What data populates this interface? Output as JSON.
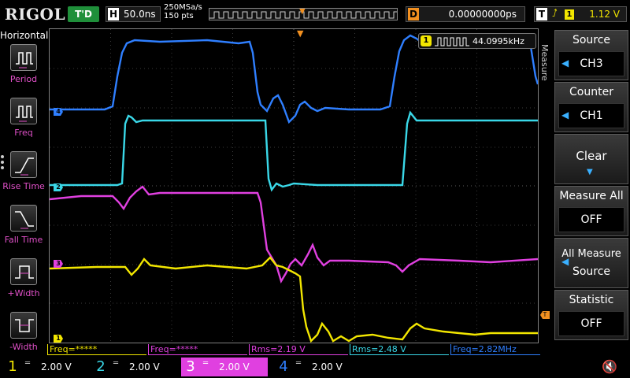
{
  "top": {
    "brand": "RIGOL",
    "trigger_status": "T'D",
    "timebase_label": "H",
    "timebase_value": "50.0ns",
    "sample_rate": "250MSa/s",
    "memory_depth": "150 pts",
    "delay_label": "D",
    "delay_value": "0.00000000ps",
    "trigger_label": "T",
    "trigger_source": "1",
    "trigger_level": "1.12 V"
  },
  "left_menu": {
    "title": "Horizontal",
    "items": [
      {
        "label": "Period",
        "icon": "period-icon"
      },
      {
        "label": "Freq",
        "icon": "freq-icon"
      },
      {
        "label": "Rise Time",
        "icon": "rise-time-icon"
      },
      {
        "label": "Fall Time",
        "icon": "fall-time-icon"
      },
      {
        "label": "+Width",
        "icon": "positive-width-icon"
      },
      {
        "label": "-Width",
        "icon": "negative-width-icon"
      }
    ]
  },
  "counter": {
    "channel": "1",
    "value": "44.0995kHz"
  },
  "channel_markers": [
    {
      "id": "4",
      "color": "#2f7fff"
    },
    {
      "id": "2",
      "color": "#3ad8e8"
    },
    {
      "id": "3",
      "color": "#e040e0"
    },
    {
      "id": "1",
      "color": "#f2e600"
    }
  ],
  "measurements": [
    {
      "text": "Freq=*****",
      "color": "#f2e600"
    },
    {
      "text": "Freq=*****",
      "color": "#e040e0"
    },
    {
      "text": "Rms=2.19 V",
      "color": "#e040e0"
    },
    {
      "text": "Rms=2.48 V",
      "color": "#3ad8e8"
    },
    {
      "text": "Freq=2.82MHz",
      "color": "#2f7fff"
    }
  ],
  "right_menu": {
    "vertical_label": "Measure",
    "source_title": "Source",
    "source_value": "CH3",
    "counter_title": "Counter",
    "counter_value": "CH1",
    "clear_title": "Clear",
    "measure_all_title": "Measure All",
    "measure_all_value": "OFF",
    "all_measure_source_line1": "All Measure",
    "all_measure_source_line2": "Source",
    "statistic_title": "Statistic",
    "statistic_value": "OFF"
  },
  "channels": [
    {
      "num": "1",
      "scale": "2.00 V",
      "color": "#f2e600"
    },
    {
      "num": "2",
      "scale": "2.00 V",
      "color": "#3ad8e8"
    },
    {
      "num": "3",
      "scale": "2.00 V",
      "color": "#e040e0"
    },
    {
      "num": "4",
      "scale": "2.00 V",
      "color": "#2f7fff"
    }
  ],
  "colors": {
    "ch1": "#f2e600",
    "ch2": "#3ad8e8",
    "ch3": "#e040e0",
    "ch4": "#2f7fff",
    "trigger": "#f29020",
    "menu_label": "#e050c8"
  }
}
